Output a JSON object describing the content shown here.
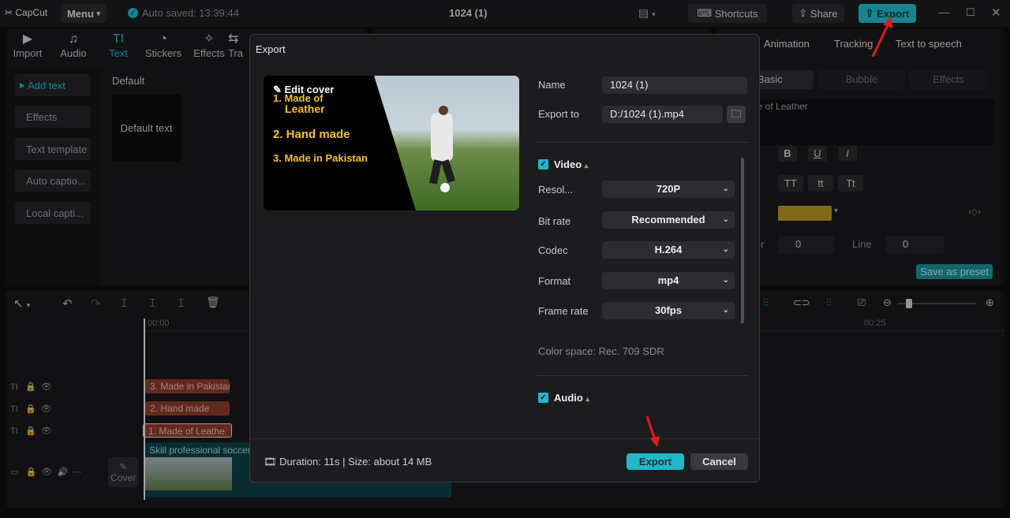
{
  "titlebar": {
    "app_name": "CapCut",
    "menu_label": "Menu",
    "autosave_text": "Auto saved: 13:39:44",
    "project_title": "1024 (1)",
    "shortcuts_label": "Shortcuts",
    "share_label": "Share",
    "export_label": "Export"
  },
  "toolbar": {
    "tools": [
      {
        "label": "Import",
        "icon": "▶"
      },
      {
        "label": "Audio",
        "icon": "♫"
      },
      {
        "label": "Text",
        "icon": "TI"
      },
      {
        "label": "Stickers",
        "icon": "◔"
      },
      {
        "label": "Effects",
        "icon": "✧"
      },
      {
        "label": "Tra",
        "icon": "⇆"
      }
    ]
  },
  "left_sidebar": {
    "items": [
      "Add text",
      "Effects",
      "Text template",
      "Auto captio...",
      "Local capti..."
    ]
  },
  "text_library": {
    "section_label": "Default",
    "card_label": "Default text"
  },
  "right_panel": {
    "tabs": [
      "Animation",
      "Tracking",
      "Text to speech"
    ],
    "subtabs": [
      "Basic",
      "Bubble",
      "Effects"
    ],
    "text_preview": "le of  Leather",
    "style_buttons": [
      "B",
      "U",
      "I"
    ],
    "case_buttons": [
      "TT",
      "tt",
      "Tt"
    ],
    "letter_label": "er",
    "letter_value": "0",
    "line_label": "Line",
    "line_value": "0",
    "save_preset_label": "Save as preset",
    "accent_color": "#b58f21"
  },
  "timeline": {
    "ruler_start": "00:00",
    "ruler_mark": "00:25",
    "clips": [
      "3. Made in Pakistan",
      "2. Hand made",
      "1. Made of   Leathe"
    ],
    "video_clip_label": "Skill professional soccer",
    "cover_label": "Cover"
  },
  "dialog": {
    "title": "Export",
    "edit_cover_label": "Edit cover",
    "preview_lines": [
      "1. Made of",
      "Leather",
      "2. Hand made",
      "3. Made in Pakistan"
    ],
    "name_label": "Name",
    "name_value": "1024 (1)",
    "export_to_label": "Export to",
    "export_to_value": "D:/1024 (1).mp4",
    "video_section": "Video",
    "video_settings": [
      {
        "label": "Resol...",
        "value": "720P"
      },
      {
        "label": "Bit rate",
        "value": "Recommended"
      },
      {
        "label": "Codec",
        "value": "H.264"
      },
      {
        "label": "Format",
        "value": "mp4"
      },
      {
        "label": "Frame rate",
        "value": "30fps"
      }
    ],
    "color_space": "Color space: Rec. 709 SDR",
    "audio_section": "Audio",
    "footer_info": "Duration: 11s | Size: about 14 MB",
    "export_button": "Export",
    "cancel_button": "Cancel"
  },
  "colors": {
    "accent": "#21b8c8",
    "annotation_arrow": "#e11a1a"
  }
}
